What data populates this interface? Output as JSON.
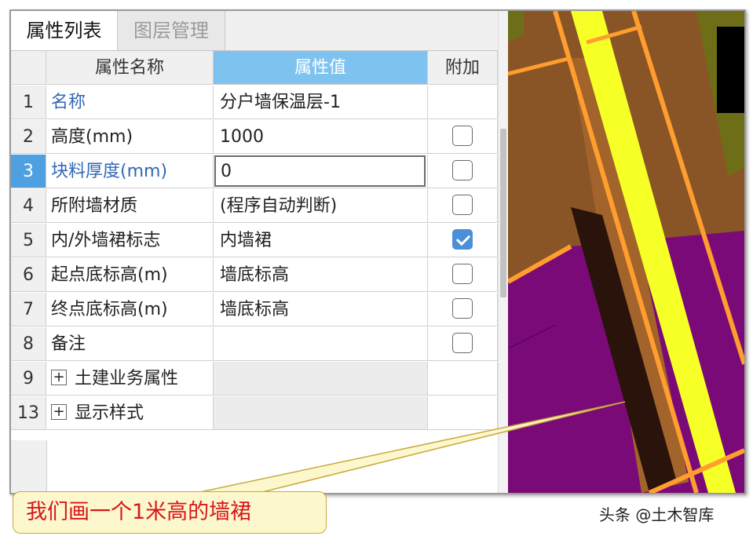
{
  "tabs": [
    {
      "label": "属性列表",
      "active": true
    },
    {
      "label": "图层管理",
      "active": false
    }
  ],
  "columns": {
    "num": "",
    "name": "属性名称",
    "value": "属性值",
    "extra": "附加"
  },
  "rows": [
    {
      "num": "1",
      "name": "名称",
      "value": "分户墙保温层-1"
    },
    {
      "num": "2",
      "name": "高度(mm)",
      "value": "1000",
      "checked": false
    },
    {
      "num": "3",
      "name": "块料厚度(mm)",
      "value": "0",
      "checked": false
    },
    {
      "num": "4",
      "name": "所附墙材质",
      "value": "(程序自动判断)",
      "checked": false
    },
    {
      "num": "5",
      "name": "内/外墙裙标志",
      "value": "内墙裙",
      "checked": true
    },
    {
      "num": "6",
      "name": "起点底标高(m)",
      "value": "墙底标高",
      "checked": false
    },
    {
      "num": "7",
      "name": "终点底标高(m)",
      "value": "墙底标高",
      "checked": false
    },
    {
      "num": "8",
      "name": "备注",
      "value": "",
      "checked": false
    },
    {
      "num": "9",
      "name": "土建业务属性",
      "group": true
    },
    {
      "num": "13",
      "name": "显示样式",
      "group": true
    }
  ],
  "callout": "我们画一个1米高的墙裙",
  "watermark": "头条 @土木智库",
  "colors": {
    "header_value_bg": "#7ec3ef",
    "link_blue": "#3367b8",
    "callout_text": "#d8161b",
    "callout_bg": "#fdf7cd"
  }
}
